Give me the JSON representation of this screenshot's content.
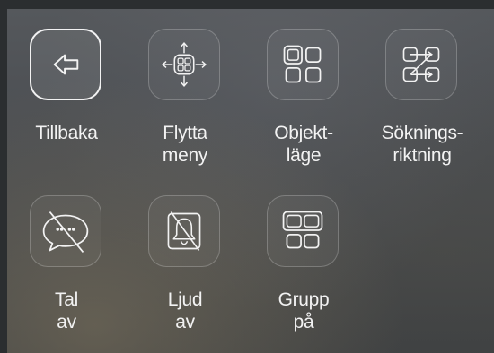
{
  "menu": {
    "items": [
      {
        "id": "back",
        "icon": "back-arrow-icon",
        "selected": true,
        "lines": [
          "Tillbaka"
        ]
      },
      {
        "id": "move-menu",
        "icon": "move-arrows-icon",
        "selected": false,
        "lines": [
          "Flytta",
          "meny"
        ]
      },
      {
        "id": "object-mode",
        "icon": "object-squares-icon",
        "selected": false,
        "lines": [
          "Objekt-",
          "läge"
        ]
      },
      {
        "id": "search-direction",
        "icon": "search-direction-icon",
        "selected": false,
        "lines": [
          "Söknings-",
          "riktning"
        ]
      },
      {
        "id": "speech-off",
        "icon": "speech-bubble-off-icon",
        "selected": false,
        "lines": [
          "Tal",
          "av"
        ]
      },
      {
        "id": "sound-off",
        "icon": "bell-off-icon",
        "selected": false,
        "lines": [
          "Ljud",
          "av"
        ]
      },
      {
        "id": "group-on",
        "icon": "group-squares-icon",
        "selected": false,
        "lines": [
          "Grupp",
          "på"
        ]
      }
    ]
  }
}
